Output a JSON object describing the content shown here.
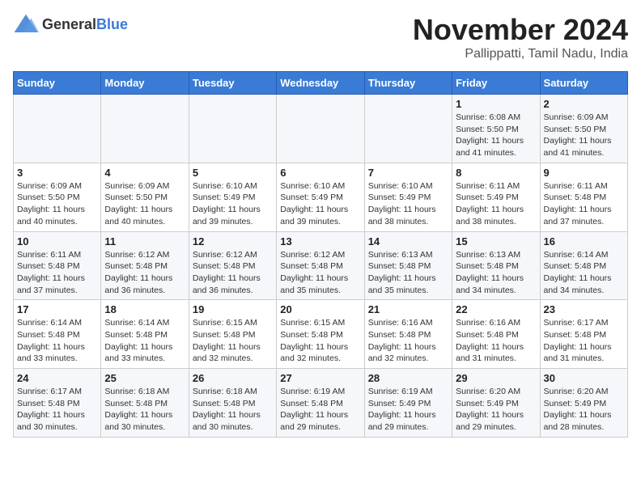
{
  "logo": {
    "general": "General",
    "blue": "Blue"
  },
  "header": {
    "title": "November 2024",
    "subtitle": "Pallippatti, Tamil Nadu, India"
  },
  "weekdays": [
    "Sunday",
    "Monday",
    "Tuesday",
    "Wednesday",
    "Thursday",
    "Friday",
    "Saturday"
  ],
  "weeks": [
    [
      {
        "day": "",
        "info": ""
      },
      {
        "day": "",
        "info": ""
      },
      {
        "day": "",
        "info": ""
      },
      {
        "day": "",
        "info": ""
      },
      {
        "day": "",
        "info": ""
      },
      {
        "day": "1",
        "info": "Sunrise: 6:08 AM\nSunset: 5:50 PM\nDaylight: 11 hours and 41 minutes."
      },
      {
        "day": "2",
        "info": "Sunrise: 6:09 AM\nSunset: 5:50 PM\nDaylight: 11 hours and 41 minutes."
      }
    ],
    [
      {
        "day": "3",
        "info": "Sunrise: 6:09 AM\nSunset: 5:50 PM\nDaylight: 11 hours and 40 minutes."
      },
      {
        "day": "4",
        "info": "Sunrise: 6:09 AM\nSunset: 5:50 PM\nDaylight: 11 hours and 40 minutes."
      },
      {
        "day": "5",
        "info": "Sunrise: 6:10 AM\nSunset: 5:49 PM\nDaylight: 11 hours and 39 minutes."
      },
      {
        "day": "6",
        "info": "Sunrise: 6:10 AM\nSunset: 5:49 PM\nDaylight: 11 hours and 39 minutes."
      },
      {
        "day": "7",
        "info": "Sunrise: 6:10 AM\nSunset: 5:49 PM\nDaylight: 11 hours and 38 minutes."
      },
      {
        "day": "8",
        "info": "Sunrise: 6:11 AM\nSunset: 5:49 PM\nDaylight: 11 hours and 38 minutes."
      },
      {
        "day": "9",
        "info": "Sunrise: 6:11 AM\nSunset: 5:48 PM\nDaylight: 11 hours and 37 minutes."
      }
    ],
    [
      {
        "day": "10",
        "info": "Sunrise: 6:11 AM\nSunset: 5:48 PM\nDaylight: 11 hours and 37 minutes."
      },
      {
        "day": "11",
        "info": "Sunrise: 6:12 AM\nSunset: 5:48 PM\nDaylight: 11 hours and 36 minutes."
      },
      {
        "day": "12",
        "info": "Sunrise: 6:12 AM\nSunset: 5:48 PM\nDaylight: 11 hours and 36 minutes."
      },
      {
        "day": "13",
        "info": "Sunrise: 6:12 AM\nSunset: 5:48 PM\nDaylight: 11 hours and 35 minutes."
      },
      {
        "day": "14",
        "info": "Sunrise: 6:13 AM\nSunset: 5:48 PM\nDaylight: 11 hours and 35 minutes."
      },
      {
        "day": "15",
        "info": "Sunrise: 6:13 AM\nSunset: 5:48 PM\nDaylight: 11 hours and 34 minutes."
      },
      {
        "day": "16",
        "info": "Sunrise: 6:14 AM\nSunset: 5:48 PM\nDaylight: 11 hours and 34 minutes."
      }
    ],
    [
      {
        "day": "17",
        "info": "Sunrise: 6:14 AM\nSunset: 5:48 PM\nDaylight: 11 hours and 33 minutes."
      },
      {
        "day": "18",
        "info": "Sunrise: 6:14 AM\nSunset: 5:48 PM\nDaylight: 11 hours and 33 minutes."
      },
      {
        "day": "19",
        "info": "Sunrise: 6:15 AM\nSunset: 5:48 PM\nDaylight: 11 hours and 32 minutes."
      },
      {
        "day": "20",
        "info": "Sunrise: 6:15 AM\nSunset: 5:48 PM\nDaylight: 11 hours and 32 minutes."
      },
      {
        "day": "21",
        "info": "Sunrise: 6:16 AM\nSunset: 5:48 PM\nDaylight: 11 hours and 32 minutes."
      },
      {
        "day": "22",
        "info": "Sunrise: 6:16 AM\nSunset: 5:48 PM\nDaylight: 11 hours and 31 minutes."
      },
      {
        "day": "23",
        "info": "Sunrise: 6:17 AM\nSunset: 5:48 PM\nDaylight: 11 hours and 31 minutes."
      }
    ],
    [
      {
        "day": "24",
        "info": "Sunrise: 6:17 AM\nSunset: 5:48 PM\nDaylight: 11 hours and 30 minutes."
      },
      {
        "day": "25",
        "info": "Sunrise: 6:18 AM\nSunset: 5:48 PM\nDaylight: 11 hours and 30 minutes."
      },
      {
        "day": "26",
        "info": "Sunrise: 6:18 AM\nSunset: 5:48 PM\nDaylight: 11 hours and 30 minutes."
      },
      {
        "day": "27",
        "info": "Sunrise: 6:19 AM\nSunset: 5:48 PM\nDaylight: 11 hours and 29 minutes."
      },
      {
        "day": "28",
        "info": "Sunrise: 6:19 AM\nSunset: 5:49 PM\nDaylight: 11 hours and 29 minutes."
      },
      {
        "day": "29",
        "info": "Sunrise: 6:20 AM\nSunset: 5:49 PM\nDaylight: 11 hours and 29 minutes."
      },
      {
        "day": "30",
        "info": "Sunrise: 6:20 AM\nSunset: 5:49 PM\nDaylight: 11 hours and 28 minutes."
      }
    ]
  ]
}
